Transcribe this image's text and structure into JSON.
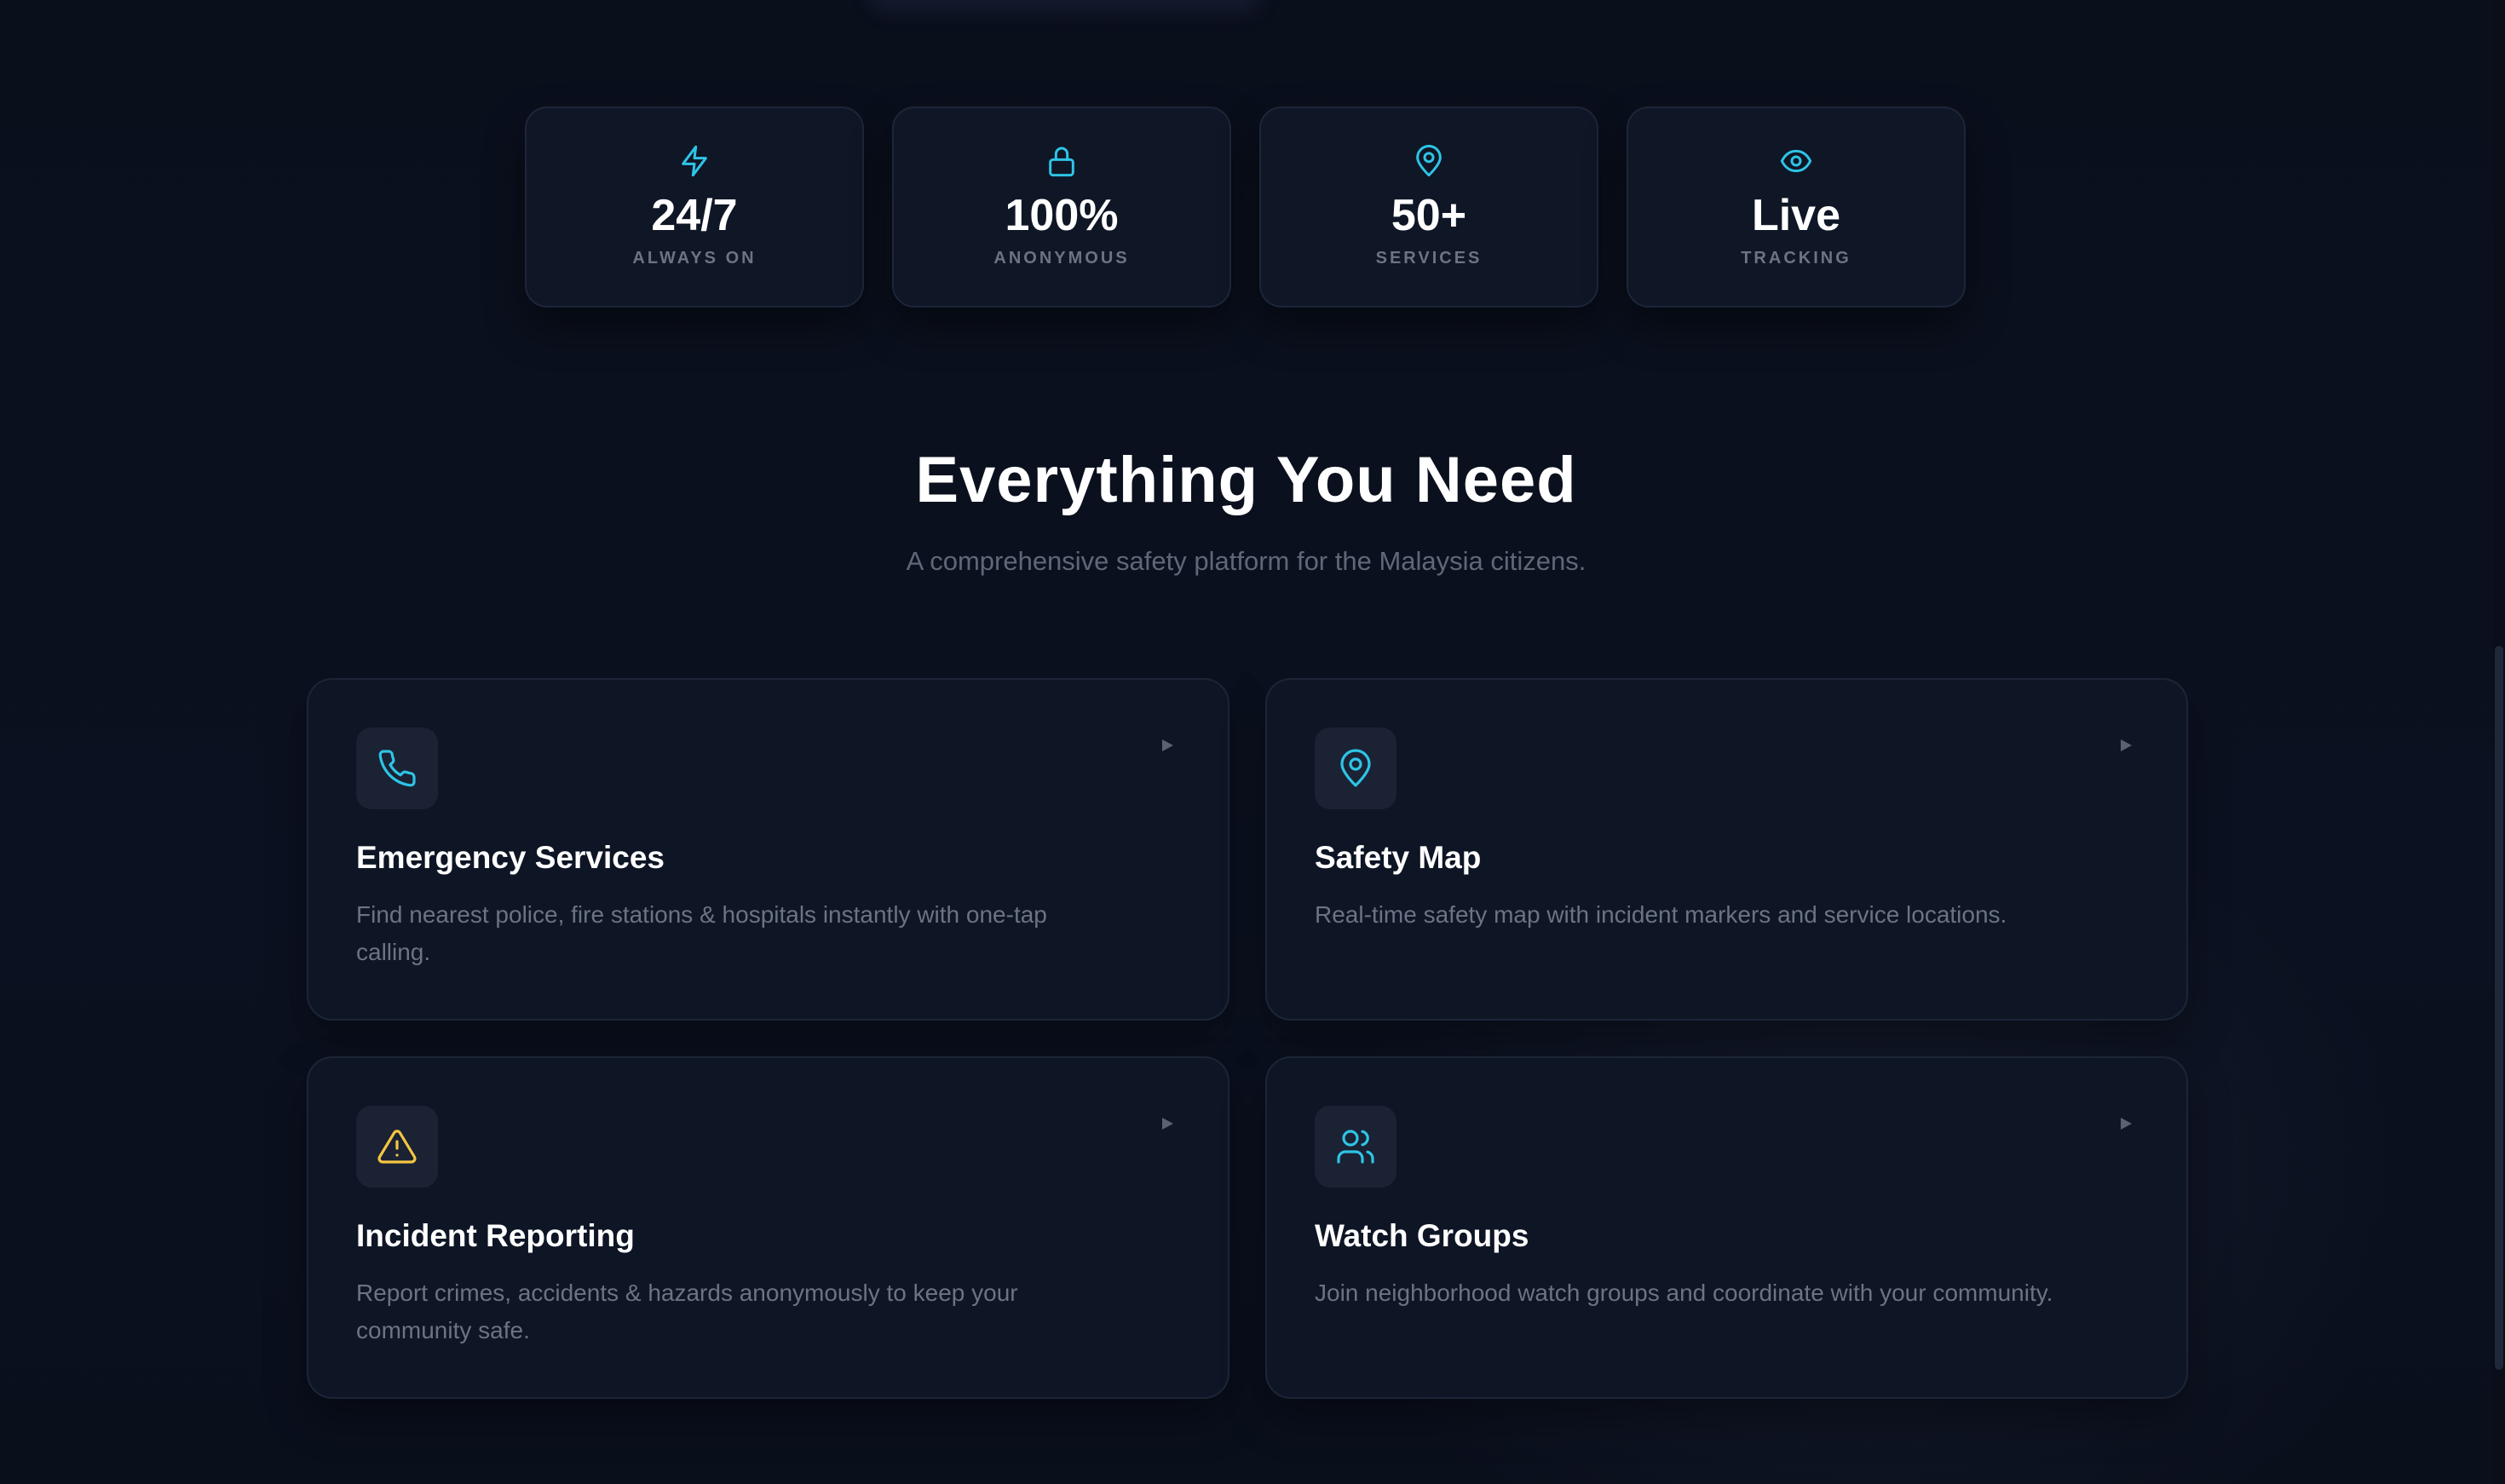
{
  "colors": {
    "accent": "#2ec4e6",
    "warning": "#f5c542",
    "background": "#0a0f1c",
    "card": "#0f1626",
    "muted_text": "#6b7384"
  },
  "stats": [
    {
      "icon": "lightning-icon",
      "value": "24/7",
      "label": "ALWAYS ON"
    },
    {
      "icon": "lock-icon",
      "value": "100%",
      "label": "ANONYMOUS"
    },
    {
      "icon": "map-pin-icon",
      "value": "50+",
      "label": "SERVICES"
    },
    {
      "icon": "eye-icon",
      "value": "Live",
      "label": "TRACKING"
    }
  ],
  "section": {
    "title": "Everything You Need",
    "subtitle": "A comprehensive safety platform for the Malaysia citizens."
  },
  "features": [
    {
      "icon": "phone-icon",
      "title": "Emergency Services",
      "description": "Find nearest police, fire stations & hospitals instantly with one-tap calling.",
      "arrow": "▶"
    },
    {
      "icon": "map-pin-icon",
      "title": "Safety Map",
      "description": "Real-time safety map with incident markers and service locations.",
      "arrow": "▶"
    },
    {
      "icon": "warning-triangle-icon",
      "title": "Incident Reporting",
      "description": "Report crimes, accidents & hazards anonymously to keep your community safe.",
      "arrow": "▶"
    },
    {
      "icon": "users-icon",
      "title": "Watch Groups",
      "description": "Join neighborhood watch groups and coordinate with your community.",
      "arrow": "▶"
    }
  ]
}
